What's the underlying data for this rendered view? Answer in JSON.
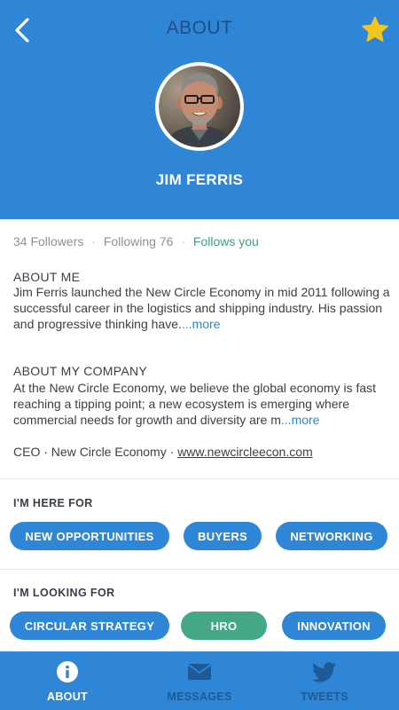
{
  "header": {
    "title": "ABOUT",
    "back_icon": "chevron-left-icon",
    "favorite_icon": "star-icon",
    "favorite_color": "#f4c51c"
  },
  "profile": {
    "name": "JIM FERRIS",
    "avatar_icon": "profile-photo"
  },
  "stats": {
    "followers": "34 Followers",
    "following": "Following 76",
    "follows_you": "Follows you",
    "separator": "·"
  },
  "about_me": {
    "title": "ABOUT ME",
    "body": "Jim Ferris launched the New Circle Economy in mid 2011 following a successful career in the logistics and shipping industry. His passion and progressive thinking have.",
    "more": "...more"
  },
  "about_company": {
    "title": "ABOUT MY COMPANY",
    "body": "At the New Circle Economy, we believe the global economy is fast reaching a tipping point; a new ecosystem is emerging where commercial needs for growth and diversity are m",
    "more": "...more"
  },
  "role": {
    "position": "CEO",
    "company": "New Circle Economy",
    "website": "www.newcircleecon.com"
  },
  "here_for": {
    "title": "I'M HERE FOR",
    "tags": [
      "NEW OPPORTUNITIES",
      "BUYERS",
      "NETWORKING"
    ]
  },
  "looking_for": {
    "title": "I'M LOOKING FOR",
    "tags": [
      "CIRCULAR STRATEGY",
      "HRO",
      "INNOVATION"
    ]
  },
  "nav": {
    "items": [
      {
        "label": "ABOUT",
        "icon": "info-icon",
        "active": true
      },
      {
        "label": "MESSAGES",
        "icon": "envelope-icon",
        "active": false
      },
      {
        "label": "TWEETS",
        "icon": "twitter-bird-icon",
        "active": false
      }
    ]
  },
  "colors": {
    "brand_blue": "#2f86d6",
    "dark_blue": "#1e4f86",
    "green": "#44a885",
    "text": "#3a3f47",
    "muted": "#8c9199"
  }
}
